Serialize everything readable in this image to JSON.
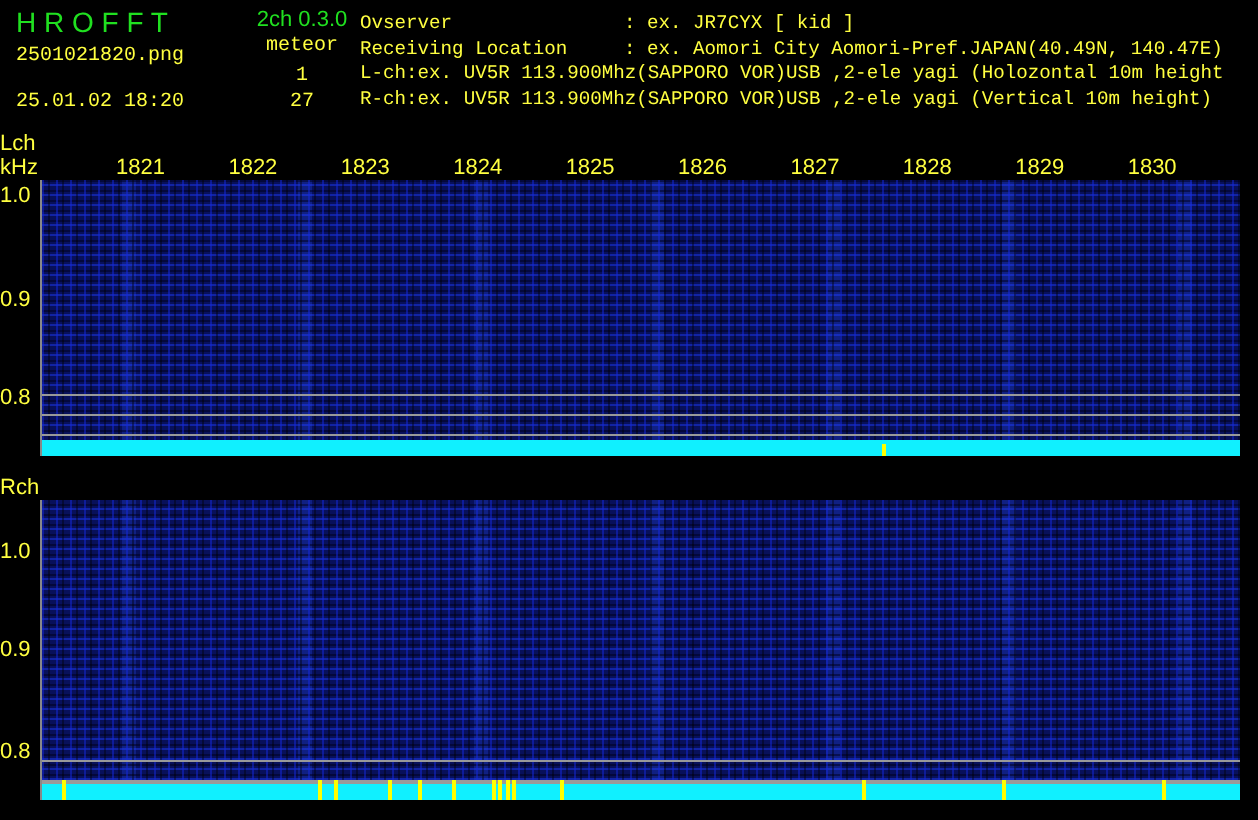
{
  "app": {
    "name": "H R O F F T",
    "version": "2ch 0.3.0"
  },
  "file": {
    "name": "2501021820.png",
    "datetime": "25.01.02 18:20"
  },
  "meteor": {
    "label": "meteor",
    "counts": [
      "1",
      "27"
    ]
  },
  "station": [
    {
      "kind": "field",
      "label": "Ovserver",
      "value": ": ex. JR7CYX [ kid ]"
    },
    {
      "kind": "field",
      "label": "Receiving Location",
      "value": ": ex. Aomori City Aomori-Pref.JAPAN(40.49N, 140.47E)"
    },
    {
      "kind": "line",
      "text": "L-ch:ex. UV5R 113.900Mhz(SAPPORO VOR)USB ,2-ele yagi (Holozontal 10m height"
    },
    {
      "kind": "line",
      "text": "R-ch:ex. UV5R 113.900Mhz(SAPPORO VOR)USB ,2-ele yagi (Vertical 10m height)"
    }
  ],
  "panels": [
    {
      "channel": "Lch",
      "unit": "kHz",
      "x_ticks": [
        "1821",
        "1822",
        "1823",
        "1824",
        "1825",
        "1826",
        "1827",
        "1828",
        "1829",
        "1830"
      ],
      "y_ticks": [
        "1.0",
        "0.9",
        "0.8"
      ]
    },
    {
      "channel": "Rch",
      "y_ticks": [
        "1.0",
        "0.9",
        "0.8"
      ]
    }
  ]
}
